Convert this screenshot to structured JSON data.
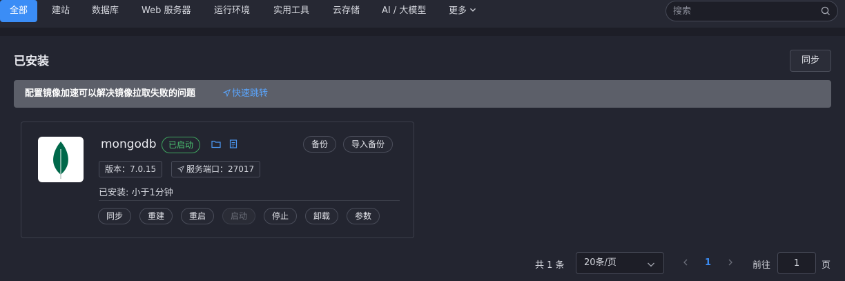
{
  "nav": {
    "tabs": [
      {
        "label": "全部",
        "active": true
      },
      {
        "label": "建站"
      },
      {
        "label": "数据库"
      },
      {
        "label": "Web 服务器"
      },
      {
        "label": "运行环境"
      },
      {
        "label": "实用工具"
      },
      {
        "label": "云存储"
      },
      {
        "label": "AI / 大模型"
      },
      {
        "label": "更多"
      }
    ],
    "search_placeholder": "搜索"
  },
  "page": {
    "title": "已安装",
    "sync_button": "同步"
  },
  "alert": {
    "message": "配置镜像加速可以解决镜像拉取失败的问题",
    "link": "快速跳转"
  },
  "app": {
    "name": "mongodb",
    "status": "已启动",
    "backup_button": "备份",
    "import_backup_button": "导入备份",
    "version": "版本：7.0.15",
    "port": "服务端口：27017",
    "installed": "已安装:  小于1分钟",
    "actions": [
      "同步",
      "重建",
      "重启",
      "启动",
      "停止",
      "卸载",
      "参数"
    ],
    "disabled_action": "启动"
  },
  "pagination": {
    "total": "共 1 条",
    "page_size": "20条/页",
    "current_page": "1",
    "goto_label": "前往",
    "goto_value": "1",
    "page_suffix": "页"
  },
  "colors": {
    "accent": "#3b8df6",
    "status_green": "#4cc472",
    "link": "#5aa6ff",
    "mongodb_leaf": "#13aa52"
  }
}
